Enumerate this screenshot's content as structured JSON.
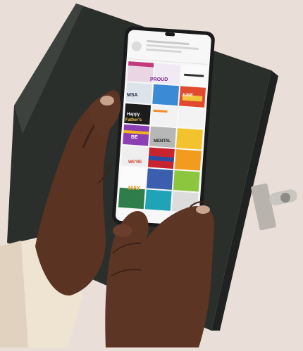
{
  "photo": {
    "tiles": {
      "t_b": "WE'RE",
      "t_rainbow": "BE",
      "t_proud": "PROUD",
      "t_may": "MAY",
      "t_father": "Happy",
      "t_father2": "Father's",
      "t_msa": "MSA",
      "t_mental": "MENTAL",
      "t_june": "JUNE"
    }
  }
}
